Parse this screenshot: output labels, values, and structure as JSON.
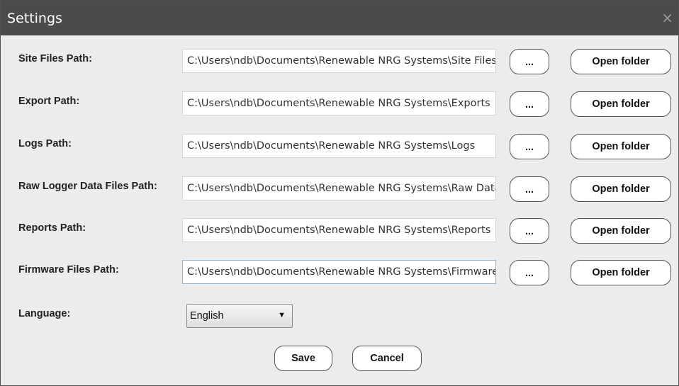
{
  "window": {
    "title": "Settings",
    "close_glyph": "×"
  },
  "rows": [
    {
      "label": "Site Files Path:",
      "value": "C:\\Users\\ndb\\Documents\\Renewable NRG Systems\\Site Files",
      "browse_label": "...",
      "open_label": "Open folder"
    },
    {
      "label": "Export Path:",
      "value": "C:\\Users\\ndb\\Documents\\Renewable NRG Systems\\Exports",
      "browse_label": "...",
      "open_label": "Open folder"
    },
    {
      "label": "Logs Path:",
      "value": "C:\\Users\\ndb\\Documents\\Renewable NRG Systems\\Logs",
      "browse_label": "...",
      "open_label": "Open folder"
    },
    {
      "label": "Raw Logger Data Files Path:",
      "value": "C:\\Users\\ndb\\Documents\\Renewable NRG Systems\\Raw Data",
      "browse_label": "...",
      "open_label": "Open folder"
    },
    {
      "label": "Reports Path:",
      "value": "C:\\Users\\ndb\\Documents\\Renewable NRG Systems\\Reports",
      "browse_label": "...",
      "open_label": "Open folder"
    },
    {
      "label": "Firmware Files Path:",
      "value": "C:\\Users\\ndb\\Documents\\Renewable NRG Systems\\Firmware",
      "browse_label": "...",
      "open_label": "Open folder"
    }
  ],
  "language": {
    "label": "Language:",
    "selected": "English",
    "arrow_glyph": "▼"
  },
  "footer": {
    "save_label": "Save",
    "cancel_label": "Cancel"
  },
  "colors": {
    "titlebar": "#4b4b4b",
    "background": "#ececec",
    "focus_border": "#8fb5d8"
  },
  "icons": {
    "close": "close-icon",
    "dropdown": "chevron-down-icon"
  }
}
